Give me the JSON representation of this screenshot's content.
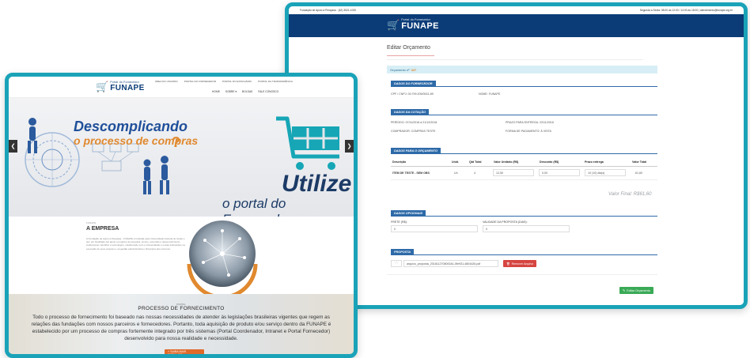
{
  "back_window": {
    "topbar": {
      "contact": "Fundação de Apoio à Pesquisa  ·  (62) 3521-1000",
      "hours": "Segunda a Sexta: 08:00 às 12:00 / 14:00 às 18:00    |    atendimento@funape.org.br"
    },
    "logo": {
      "subtitle": "Portal do Fornecedor",
      "name": "FUNAPE"
    },
    "page_title": "Editar Orçamento",
    "orcamento": {
      "label": "Orçamento nº",
      "number": "327"
    },
    "fornecedor": {
      "section_title": "DADOS DO FORNECEDOR",
      "cpf_cnpj": "CPF / CNPJ: 00.799.205/0001-89",
      "nome": "NOME: FUNAPE"
    },
    "cotacao": {
      "section_title": "DADOS DA COTAÇÃO",
      "periodo": "PERÍODO: 07/11/2018 à 21/12/2018",
      "prazo_entrega": "PRAZO PARA ENTREGA: 22/11/2018",
      "comprador": "COMPRADOR: COMPRAS TESTE",
      "forma_pagamento": "FORMA DE PAGAMENTO: À VISTA"
    },
    "orcamento_data": {
      "section_title": "DADOS PARA O ORÇAMENTO",
      "columns": [
        "Descrição",
        "Unid.",
        "Qtd Total",
        "Valor Unitário (R$)",
        "Desconto (R$)",
        "Prazo entrega",
        "Valor Total"
      ],
      "row": {
        "descricao": "ITEM DE TESTE - SEM OBS",
        "unid": "Un",
        "qtd": "4",
        "valor_unitario": "12,50",
        "desconto": "0,00",
        "prazo": "10 (10) dia(s)",
        "valor_total": "61,60"
      },
      "valor_final": "Valor Final: R$61,60"
    },
    "opcionais": {
      "section_title": "DADOS OPCIONAIS",
      "frete_label": "FRETE (R$):",
      "frete_value": "0",
      "validade_label": "VALIDADE DA PROPOSTA (DIAS):",
      "validade_value": "0"
    },
    "proposta": {
      "section_title": "PROPOSTA",
      "file_name": "arquivo_proposta_2018112708000A1-5fe931-4804426.pdf",
      "remove_label": "Remover Arquivo"
    },
    "submit_label": "Editar Orçamento"
  },
  "front_window": {
    "logo": {
      "subtitle": "Portal do Fornecedor",
      "name": "FUNAPE"
    },
    "nav_top": [
      "ÁREA DO USUÁRIO",
      "PORTAL DO FORNECEDOR",
      "PORTAL DO ESTAGIÁRIO",
      "PORTAL DA TRANSPARÊNCIA"
    ],
    "nav_main": [
      "HOME",
      "SOBRE ▾",
      "BOLSAS",
      "FALE CONOSCO"
    ],
    "hero": {
      "line1": "Descomplicando",
      "line2": "o processo de compras",
      "utilize": "Utilize",
      "portal": "o portal do Fornecedor"
    },
    "about": {
      "kicker": "FUNAPE",
      "title": "A EMPRESA",
      "body": "A Fundação de Apoio à Pesquisa - FUNAPE é fundada pela Universidade Federal de Goiás e tem por finalidade dar apoio a projetos de pesquisa, ensino, extensão e desenvolvimento institucional, científico e tecnológico, colaborando com a Universidade e outras instituições na execução de seus projetos e na gestão administrativa e financeira dos recursos."
    },
    "process": {
      "kicker": "PORTAL",
      "title": "PROCESSO DE FORNECIMENTO",
      "body": "Todo o processo de fornecimento foi baseado nas nossas necessidades de atender às legislações brasileiras vigentes que regem as relações das fundações com nossos parceiros e fornecedores. Portanto, toda aquisição de produto e/ou serviço dentro da FUNAPE é estabelecido por um processo de compras fortemente integrado por três sistemas (Portal Coordenador, Intranet e Portal Fornecedor) desenvolvido para nossa realidade e necessidade.",
      "button": "+ SAIBA MAIS DETALHES"
    }
  },
  "colors": {
    "frame": "#1aa3b8",
    "navy": "#0b3c78",
    "section": "#2e6aa8",
    "orange": "#e0892f",
    "green": "#3aaa57",
    "red": "#d64541"
  }
}
